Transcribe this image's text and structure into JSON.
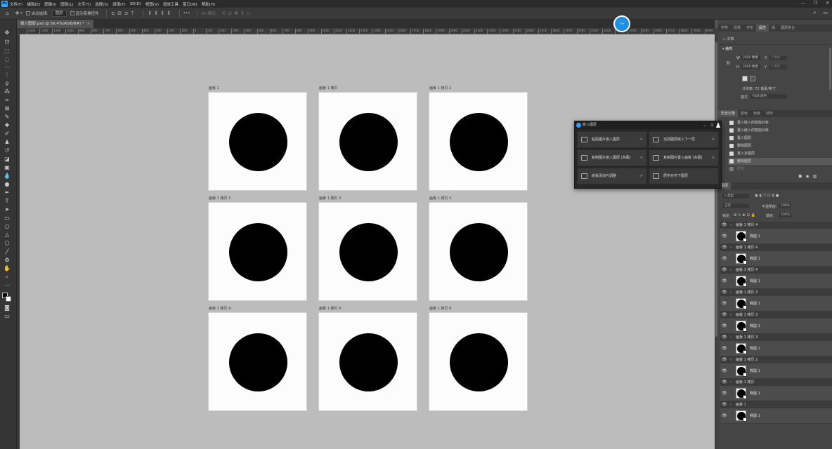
{
  "menu": [
    "文件(F)",
    "编辑(E)",
    "图像(I)",
    "图层(L)",
    "文字(Y)",
    "选择(S)",
    "滤镜(T)",
    "3D(D)",
    "视图(V)",
    "增效工具",
    "窗口(W)",
    "帮助(H)"
  ],
  "window_buttons": [
    "—",
    "❐",
    "✕"
  ],
  "options": {
    "auto_select_label": "自动选择:",
    "auto_select_value": "图层",
    "show_transform_label": "显示变换控件",
    "mode_3d_label": "3D 模式:",
    "more": "•••"
  },
  "document_tab": {
    "title": "嵌入图层.psd @ 56.4%(RGB/8#) *",
    "close": "×"
  },
  "ruler_ticks": [
    "1300",
    "1200",
    "1100",
    "1000",
    "900",
    "800",
    "700",
    "600",
    "500",
    "400",
    "300",
    "200",
    "100",
    "0",
    "100",
    "200",
    "300",
    "400",
    "500",
    "600",
    "700",
    "800",
    "900",
    "1000",
    "1100",
    "1200",
    "1300",
    "1400",
    "1500",
    "1600",
    "1700",
    "1800",
    "1900",
    "2000",
    "2100",
    "2200",
    "2300",
    "2400",
    "2500",
    "2600",
    "2700",
    "2800",
    "2900",
    "3000",
    "3100",
    "3200",
    "3300",
    "3400",
    "3500",
    "3600",
    "3700",
    "3800",
    "3900",
    "4000",
    "4100"
  ],
  "badge_text": "〰",
  "artboards": [
    {
      "label": "画板 1"
    },
    {
      "label": "画板 1 拷贝"
    },
    {
      "label": "画板 1 拷贝 2"
    },
    {
      "label": "画板 1 拷贝 3"
    },
    {
      "label": "画板 1 拷贝 3"
    },
    {
      "label": "画板 1 拷贝 3"
    },
    {
      "label": "画板 1 拷贝 4"
    },
    {
      "label": "画板 1 拷贝 4"
    },
    {
      "label": "画板 1 拷贝 4"
    }
  ],
  "panel_tabs_top": [
    "字符",
    "段落",
    "字形",
    "属性",
    "库",
    "图层复合"
  ],
  "properties": {
    "doc_label": "文档",
    "section": "画布",
    "w_label": "W",
    "w_value": "2600 像素",
    "x_label": "X",
    "x_value": "0 像素",
    "h_label": "H",
    "h_value": "2600 像素",
    "y_label": "Y",
    "y_value": "0 像素",
    "resolution": "分辨率: 72 像素/英寸",
    "mode_label": "模式",
    "mode_value": "RGB 颜色"
  },
  "panel_tabs_history": [
    "历史记录",
    "颜色",
    "色板",
    "动作"
  ],
  "history": [
    {
      "label": "置入嵌入的智能对象",
      "state": "normal"
    },
    {
      "label": "置入嵌入的智能对象",
      "state": "normal"
    },
    {
      "label": "置入图层",
      "state": "normal"
    },
    {
      "label": "删除图层",
      "state": "normal"
    },
    {
      "label": "置入多图层",
      "state": "normal"
    },
    {
      "label": "删除图层",
      "state": "selected"
    },
    {
      "label": "原位",
      "state": "dim"
    }
  ],
  "layers_panel": {
    "tab": "图层",
    "filter_label": "类型",
    "blend_mode": "正常",
    "opacity_label": "不透明度:",
    "opacity_value": "100%",
    "lock_label": "锁定:",
    "fill_label": "填充:",
    "fill_value": "100%"
  },
  "layers": [
    {
      "group": "画板 1 拷贝 4",
      "child": "椭圆 1"
    },
    {
      "group": "画板 1 拷贝 4",
      "child": "椭圆 1"
    },
    {
      "group": "画板 1 拷贝 4",
      "child": "椭圆 1"
    },
    {
      "group": "画板 1 拷贝 3",
      "child": "椭圆 1"
    },
    {
      "group": "画板 1 拷贝 3",
      "child": "椭圆 1"
    },
    {
      "group": "画板 1 拷贝 3",
      "child": "椭圆 1"
    },
    {
      "group": "画板 1 拷贝 2",
      "child": "椭圆 1"
    },
    {
      "group": "画板 1 拷贝",
      "child": "椭圆 1"
    },
    {
      "group": "画板 1",
      "child": "椭圆 1"
    }
  ],
  "popup": {
    "title": "嵌入图层",
    "buttons": [
      {
        "label": "粘贴图片嵌入图层",
        "arrow": ">"
      },
      {
        "label": "当前图层嵌入下一层",
        "arrow": ">"
      },
      {
        "label": "复制图片嵌入图层 [多图]",
        "arrow": ">"
      },
      {
        "label": "复制图片置入画板 [多图]",
        "arrow": ">"
      },
      {
        "label": "嵌板添加与调整",
        "arrow": ">"
      },
      {
        "label": "居中对齐下图层",
        "arrow": ""
      }
    ]
  }
}
